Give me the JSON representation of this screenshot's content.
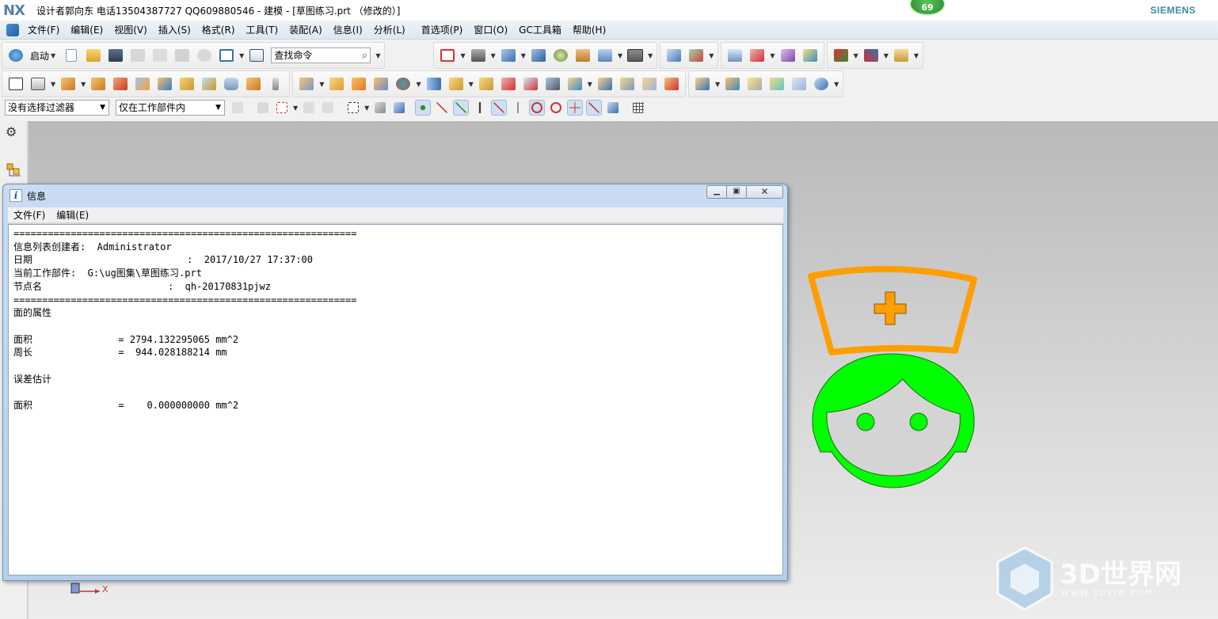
{
  "titlebar": {
    "logo": "NX",
    "title": "设计者郭向东  电话13504387727  QQ609880546 - 建模 - [草图练习.prt （修改的）]",
    "brand": "SIEMENS",
    "badge_count": "69"
  },
  "menubar": {
    "items": [
      "文件(F)",
      "编辑(E)",
      "视图(V)",
      "插入(S)",
      "格式(R)",
      "工具(T)",
      "装配(A)",
      "信息(I)",
      "分析(L)",
      "首选项(P)",
      "窗口(O)",
      "GC工具箱",
      "帮助(H)"
    ]
  },
  "toolbar": {
    "start_label": "启动",
    "search_value": "查找命令",
    "filter_value": "没有选择过滤器",
    "scope_value": "仅在工作部件内"
  },
  "dialog": {
    "title": "信息",
    "menu": [
      "文件(F)",
      "编辑(E)"
    ],
    "lines": [
      "============================================================",
      "信息列表创建者:  Administrator",
      "日期                           :  2017/10/27 17:37:00",
      "当前工作部件:  G:\\ug图集\\草图练习.prt",
      "节点名                      :  qh-20170831pjwz",
      "============================================================",
      "面的属性",
      "",
      "面积               = 2794.132295065 mm^2",
      "周长               =  944.028188214 mm",
      "",
      "误差估计",
      "",
      "面积               =    0.000000000 mm^2"
    ]
  },
  "graphics": {
    "axis_label": "X",
    "colors": {
      "cap": "#ff9e00",
      "face": "#00ff00",
      "background_top": "#b9b9b9"
    }
  },
  "watermark": {
    "text": "3D世界网",
    "url": "WWW.3DSJW.COM"
  }
}
